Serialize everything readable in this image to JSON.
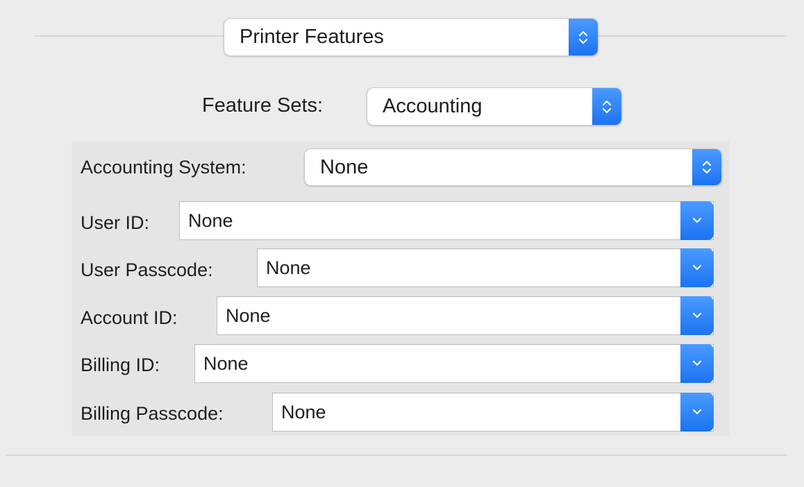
{
  "print_pane": {
    "selector": {
      "value": "Printer Features",
      "icon": "updown-chevron-icon"
    },
    "feature_sets": {
      "label": "Feature Sets:",
      "value": "Accounting",
      "icon": "updown-chevron-icon"
    },
    "accounting_system": {
      "label": "Accounting System:",
      "value": "None",
      "icon": "updown-chevron-icon"
    },
    "fields": [
      {
        "label": "User ID:",
        "value": "None",
        "icon": "chevron-down-icon"
      },
      {
        "label": "User Passcode:",
        "value": "None",
        "icon": "chevron-down-icon"
      },
      {
        "label": "Account ID:",
        "value": "None",
        "icon": "chevron-down-icon"
      },
      {
        "label": "Billing ID:",
        "value": "None",
        "icon": "chevron-down-icon"
      },
      {
        "label": "Billing Passcode:",
        "value": "None",
        "icon": "chevron-down-icon"
      }
    ]
  },
  "colors": {
    "accent": "#1c73f2",
    "background": "#ececec",
    "group_background": "#e5e5e5"
  }
}
